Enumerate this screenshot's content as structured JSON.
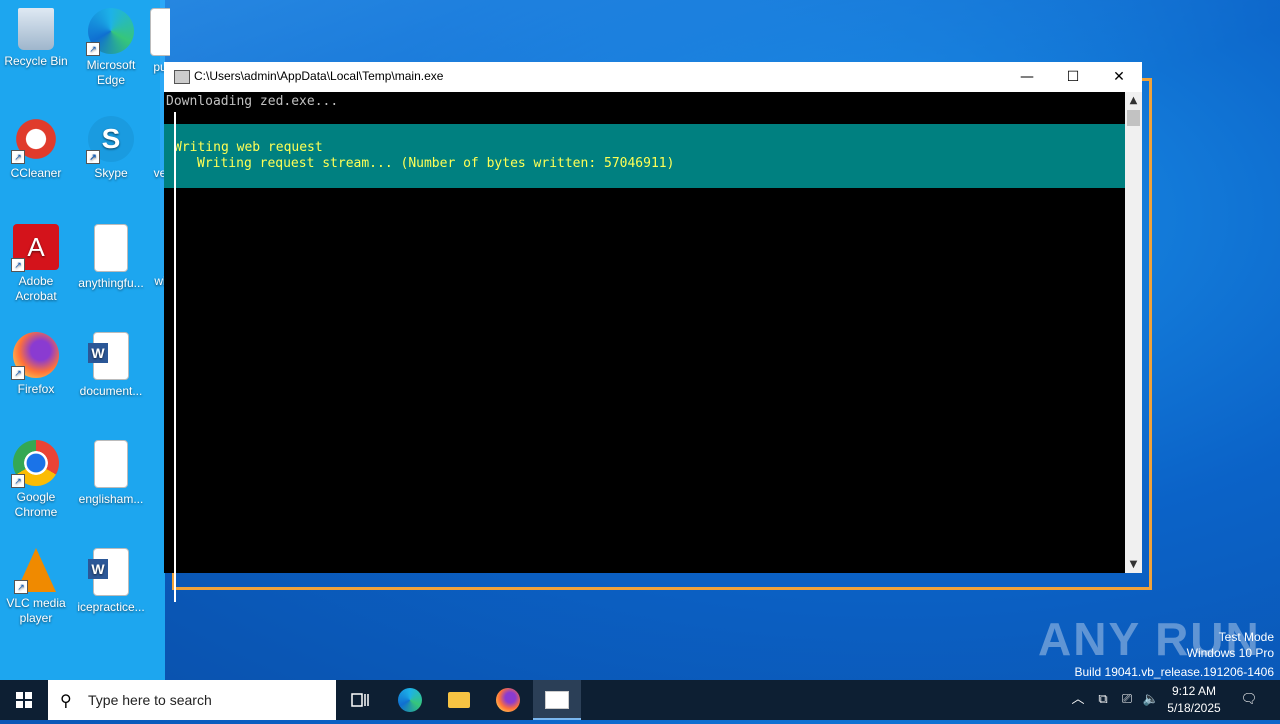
{
  "desktop": {
    "icons": [
      {
        "label": "Recycle Bin"
      },
      {
        "label": "Microsoft Edge"
      },
      {
        "label": "pu"
      },
      {
        "label": "CCleaner"
      },
      {
        "label": "Skype"
      },
      {
        "label": "ve"
      },
      {
        "label": "Adobe Acrobat"
      },
      {
        "label": "anythingfu..."
      },
      {
        "label": "wi"
      },
      {
        "label": "Firefox"
      },
      {
        "label": "document..."
      },
      {
        "label": "Google Chrome"
      },
      {
        "label": "englisham..."
      },
      {
        "label": "VLC media player"
      },
      {
        "label": "icepractice..."
      }
    ]
  },
  "console": {
    "title": "C:\\Users\\admin\\AppData\\Local\\Temp\\main.exe",
    "minimize": "—",
    "maximize": "☐",
    "close": "✕",
    "line1": "Downloading zed.exe...",
    "progress_title": "Writing web request",
    "progress_detail": "Writing request stream... (Number of bytes written: 57046911)"
  },
  "watermark": {
    "brand": "ANY RUN",
    "line1": "Test Mode",
    "line2": "Windows 10 Pro",
    "line3": "Build 19041.vb_release.191206-1406"
  },
  "taskbar": {
    "search_placeholder": "Type here to search",
    "time": "9:12 AM",
    "date": "5/18/2025"
  },
  "colors": {
    "console_bg": "#000000",
    "progress_bg": "#008080",
    "progress_text": "#ffff55",
    "frame_accent": "#f0a23a",
    "taskbar_bg": "#0d1f33"
  }
}
